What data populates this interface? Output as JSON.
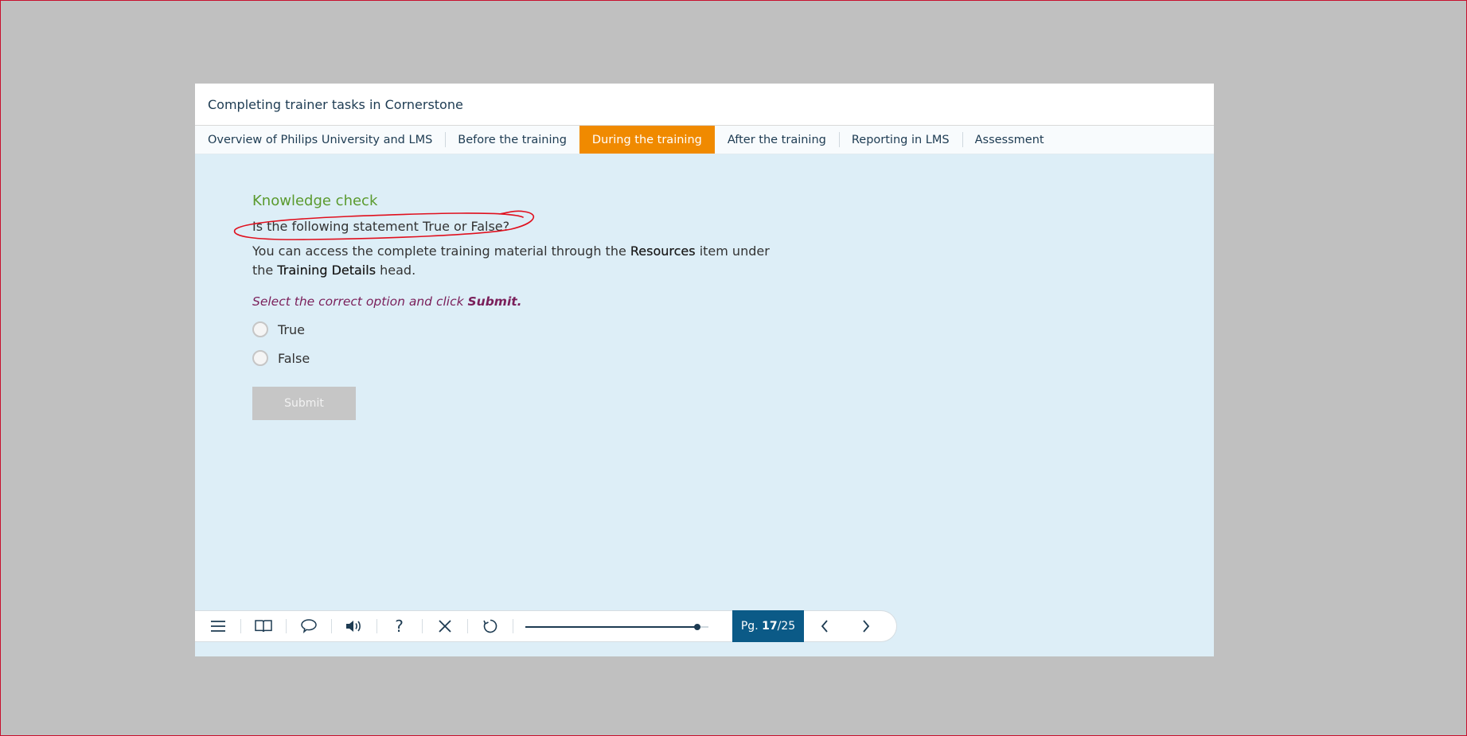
{
  "header": {
    "title": "Completing trainer tasks in Cornerstone"
  },
  "nav": {
    "items": [
      {
        "label": "Overview of Philips University and LMS",
        "active": false
      },
      {
        "label": "Before the training",
        "active": false
      },
      {
        "label": "During the training",
        "active": true
      },
      {
        "label": "After the training",
        "active": false
      },
      {
        "label": "Reporting in LMS",
        "active": false
      },
      {
        "label": "Assessment",
        "active": false
      }
    ]
  },
  "content": {
    "heading": "Knowledge check",
    "question": "Is the following statement True or False?",
    "statement": {
      "part1": "You can access the complete training material through the ",
      "bold1": "Resources",
      "part2": " item under the ",
      "bold2": "Training Details",
      "part3": " head."
    },
    "instruction": {
      "text": "Select the correct option and click ",
      "bold": "Submit."
    },
    "options": [
      "True",
      "False"
    ],
    "submit_label": "Submit"
  },
  "toolbar": {
    "icons": [
      "menu-icon",
      "book-icon",
      "comment-icon",
      "audio-icon",
      "help-icon",
      "close-icon",
      "replay-icon"
    ],
    "help_glyph": "?",
    "progress": 0.94,
    "page": {
      "prefix": "Pg. ",
      "current": "17",
      "separator": "/",
      "total": "25"
    }
  },
  "colors": {
    "active_tab": "#f08a00",
    "heading": "#5a9a2e",
    "instruction": "#7a1f5a",
    "page_box": "#0b5a87",
    "annotation": "#e0101e"
  }
}
